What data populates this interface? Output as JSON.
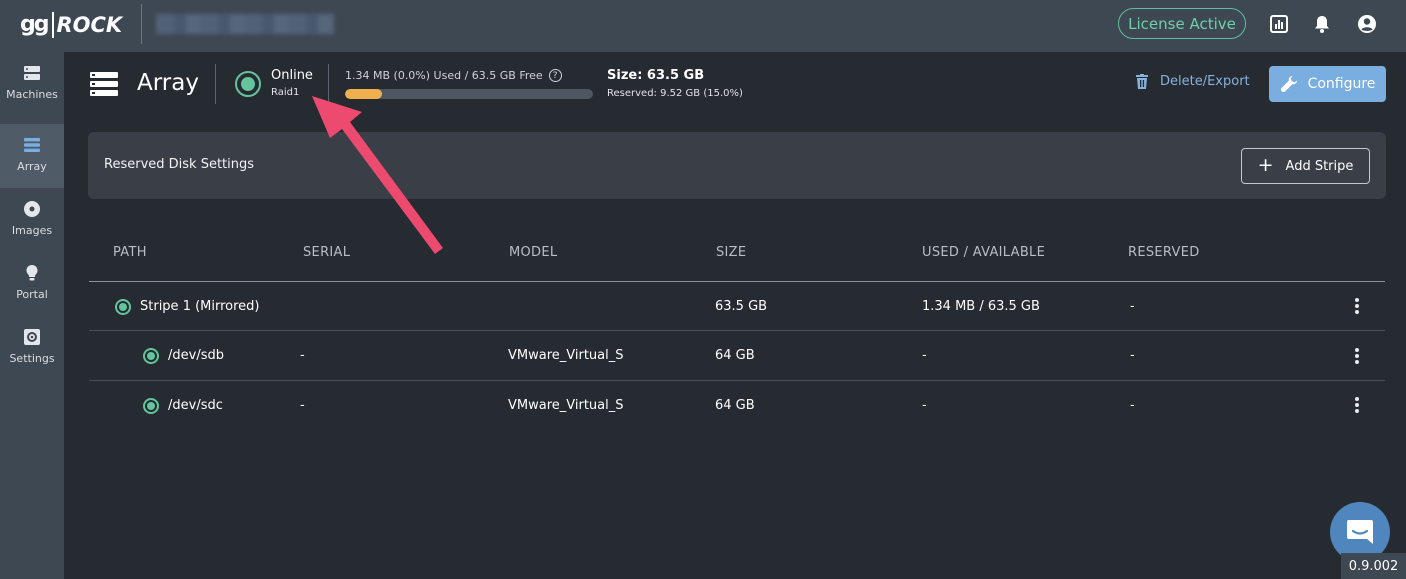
{
  "topbar": {
    "logo_left": "gg",
    "logo_right": "ROCK",
    "license_label": "License Active"
  },
  "sidebar": {
    "items": [
      {
        "label": "Machines",
        "icon": "server-icon"
      },
      {
        "label": "Array",
        "icon": "array-icon",
        "active": true
      },
      {
        "label": "Images",
        "icon": "disc-icon"
      },
      {
        "label": "Portal",
        "icon": "lightbulb-icon"
      },
      {
        "label": "Settings",
        "icon": "settings-icon"
      }
    ]
  },
  "header": {
    "title": "Array",
    "status": "Online",
    "raid": "Raid1",
    "usage": "1.34 MB (0.0%) Used / 63.5 GB Free",
    "usage_fraction": 0.15,
    "size": "Size: 63.5 GB",
    "reserved": "Reserved: 9.52 GB (15.0%)",
    "delete_label": "Delete/Export",
    "configure_label": "Configure"
  },
  "panel": {
    "title": "Reserved Disk Settings",
    "add_stripe_label": "Add Stripe"
  },
  "table": {
    "columns": [
      "PATH",
      "SERIAL",
      "MODEL",
      "SIZE",
      "USED / AVAILABLE",
      "RESERVED"
    ],
    "rows": [
      {
        "path": "Stripe 1 (Mirrored)",
        "serial": "",
        "model": "",
        "size": "63.5 GB",
        "used": "1.34 MB / 63.5 GB",
        "reserved": "-"
      },
      {
        "path": "/dev/sdb",
        "serial": "-",
        "model": "VMware_Virtual_S",
        "size": "64 GB",
        "used": "-",
        "reserved": "-"
      },
      {
        "path": "/dev/sdc",
        "serial": "-",
        "model": "VMware_Virtual_S",
        "size": "64 GB",
        "used": "-",
        "reserved": "-"
      }
    ]
  },
  "colors": {
    "accent_green": "#63c49d",
    "progress": "#f0b04e",
    "configure": "#7aaee0",
    "arrow": "#ec4a6e"
  },
  "footer": {
    "version": "0.9.002"
  }
}
